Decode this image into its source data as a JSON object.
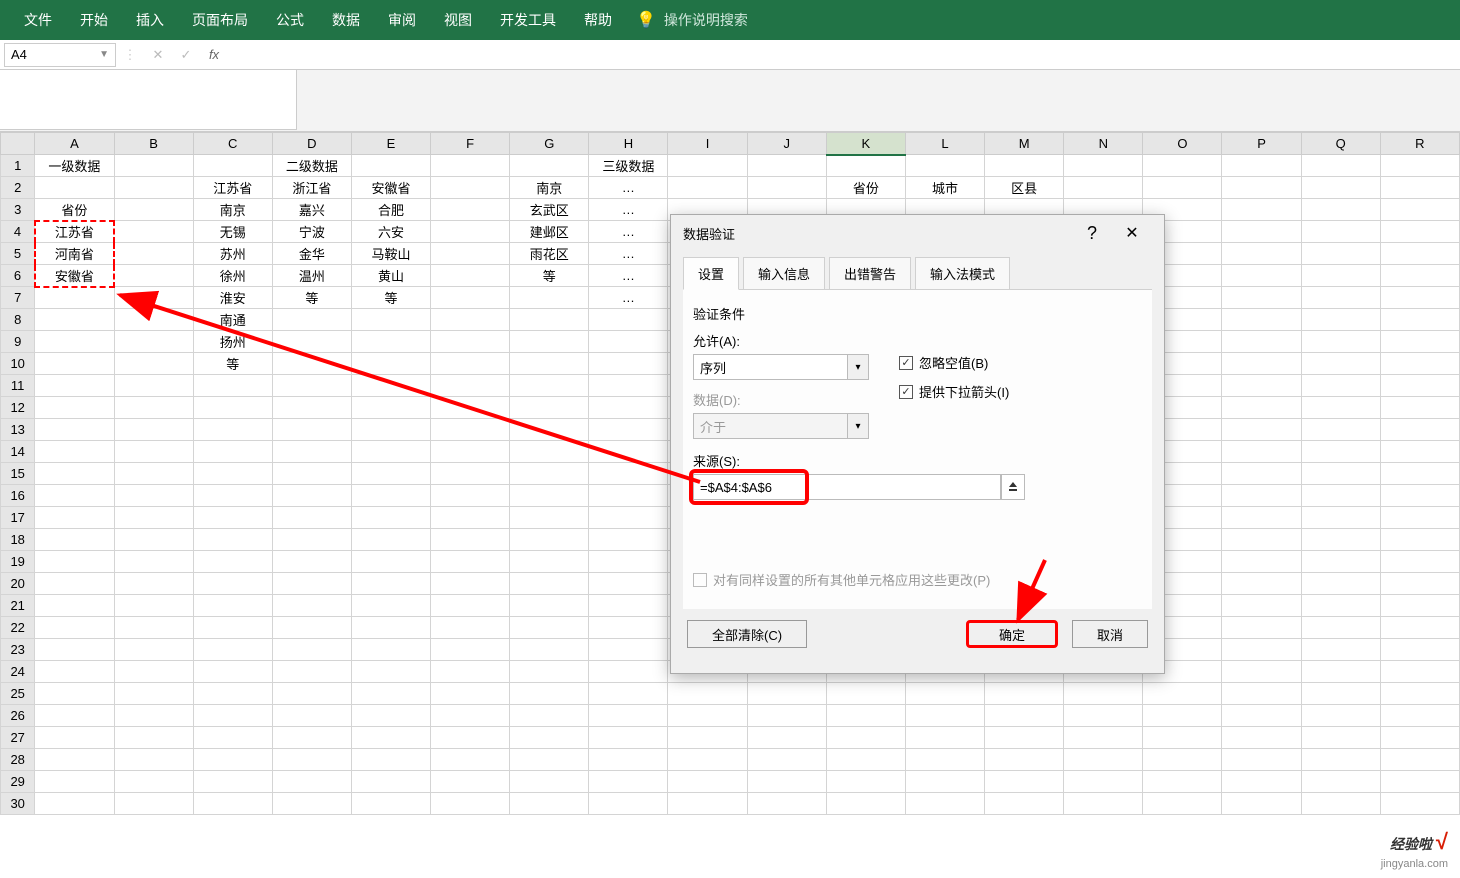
{
  "ribbon": {
    "tabs": [
      "文件",
      "开始",
      "插入",
      "页面布局",
      "公式",
      "数据",
      "审阅",
      "视图",
      "开发工具",
      "帮助"
    ],
    "search_hint": "操作说明搜索"
  },
  "namebox": "A4",
  "columns": [
    "A",
    "B",
    "C",
    "D",
    "E",
    "F",
    "G",
    "H",
    "I",
    "J",
    "K",
    "L",
    "M",
    "N",
    "O",
    "P",
    "Q",
    "R"
  ],
  "rows_count": 30,
  "active_col": "K",
  "cells": {
    "A1": "一级数据",
    "D1": "二级数据",
    "H1": "三级数据",
    "C2": "江苏省",
    "D2": "浙江省",
    "E2": "安徽省",
    "G2": "南京",
    "H2": "…",
    "A3": "省份",
    "C3": "南京",
    "D3": "嘉兴",
    "E3": "合肥",
    "G3": "玄武区",
    "H3": "…",
    "A4": "江苏省",
    "C4": "无锡",
    "D4": "宁波",
    "E4": "六安",
    "G4": "建邺区",
    "H4": "…",
    "A5": "河南省",
    "C5": "苏州",
    "D5": "金华",
    "E5": "马鞍山",
    "G5": "雨花区",
    "H5": "…",
    "A6": "安徽省",
    "C6": "徐州",
    "D6": "温州",
    "E6": "黄山",
    "G6": "等",
    "H6": "…",
    "C7": "淮安",
    "D7": "等",
    "E7": "等",
    "H7": "…",
    "C8": "南通",
    "C9": "扬州",
    "C10": "等",
    "K2": "省份",
    "L2": "城市",
    "M2": "区县"
  },
  "dialog": {
    "title": "数据验证",
    "tabs": [
      "设置",
      "输入信息",
      "出错警告",
      "输入法模式"
    ],
    "section_label": "验证条件",
    "allow_label": "允许(A):",
    "allow_value": "序列",
    "ignore_blank": "忽略空值(B)",
    "provide_dd": "提供下拉箭头(I)",
    "data_label": "数据(D):",
    "data_value": "介于",
    "source_label": "来源(S):",
    "source_value": "=$A$4:$A$6",
    "apply_same": "对有同样设置的所有其他单元格应用这些更改(P)",
    "clear": "全部清除(C)",
    "ok": "确定",
    "cancel": "取消"
  },
  "watermark": {
    "brand": "经验啦",
    "domain": "jingyanla.com"
  }
}
